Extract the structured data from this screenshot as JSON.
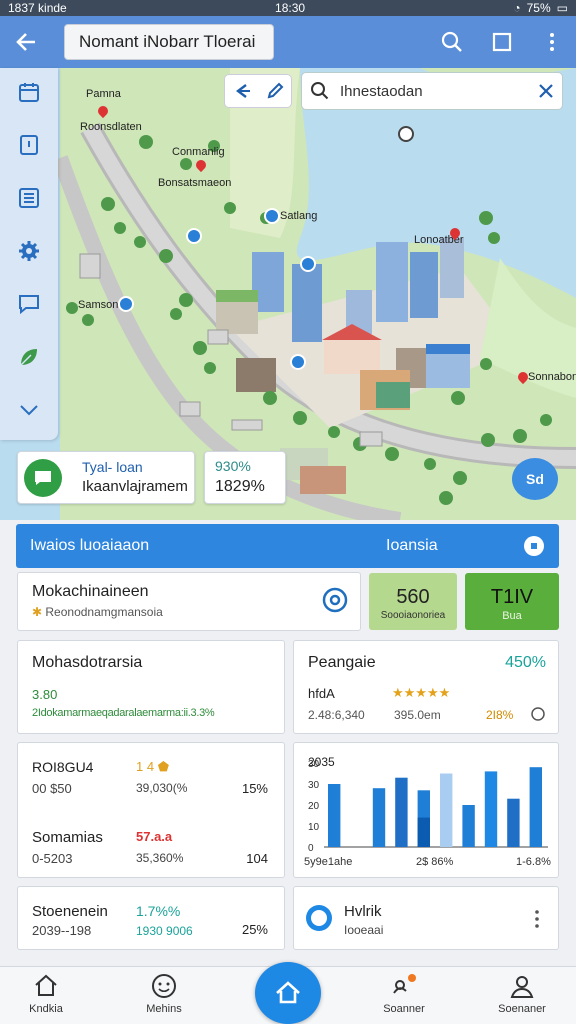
{
  "status": {
    "left": "1837 kinde",
    "time": "18:30",
    "battery": "75%"
  },
  "appbar": {
    "title": "Nomant iNobarr Tloerai"
  },
  "search": {
    "placeholder": "Ihnestaodan"
  },
  "map": {
    "labels": [
      "Pamna",
      "Roonsdlaten",
      "Conmanlig",
      "Bonsatsmaeon",
      "Satlang",
      "Lonoatber",
      "Samson",
      "Sonnabon"
    ]
  },
  "info_left": {
    "line1": "Tyal- loan",
    "line2": "Ikaanvlajramem"
  },
  "info_right": {
    "line1": "930%",
    "line2": "1829%"
  },
  "fab_map": {
    "label": "Sd"
  },
  "section": {
    "title": "Iwaios luoaiaaon",
    "right": "Ioansia"
  },
  "summary": {
    "title": "Mokachinaineen",
    "subtitle": "Reonodnamgmansoia"
  },
  "stat_a": {
    "value": "560",
    "label": "Soooiaonoriea"
  },
  "stat_b": {
    "value": "T1IV",
    "label": "Bua"
  },
  "card1": {
    "title": "Mohasdotrarsia",
    "value": "3.80",
    "detail": "2Idokamarmaeqadaralaemarma:ii.3.3%"
  },
  "card2": {
    "title": "Peangaie",
    "percent": "450%",
    "sub1": "hfdA",
    "sub2": "2.48:6,340",
    "sub3": "395.0em",
    "sub4": "2I8%"
  },
  "card3": {
    "rows": [
      {
        "name": "ROI8GU4",
        "sub": "00 $50",
        "badge": "1 4",
        "amount": "39,030(%",
        "pct": "15%"
      },
      {
        "name": "Somamias",
        "sub": "0-5203",
        "badge": "57.a.a",
        "amount": "35,360%",
        "pct": "104"
      }
    ]
  },
  "card4": {
    "title": "2035",
    "yticks": [
      "30",
      "30",
      "20",
      "10",
      "0"
    ],
    "xlabels": [
      "5y9e1ahe",
      "2$ 86%",
      "1-6.8%"
    ]
  },
  "chart_data": {
    "type": "bar",
    "title": "2035",
    "xlabel": "",
    "ylabel": "",
    "ylim": [
      0,
      40
    ],
    "series": [
      {
        "values": [
          30,
          0,
          28,
          0,
          27,
          0,
          20,
          0,
          0,
          38
        ]
      },
      {
        "values": [
          0,
          0,
          0,
          0,
          0,
          35,
          0,
          0,
          0,
          0
        ]
      },
      {
        "values": [
          0,
          0,
          0,
          33,
          0,
          0,
          0,
          0,
          23,
          0
        ]
      },
      {
        "values": [
          0,
          0,
          0,
          0,
          0,
          0,
          0,
          36,
          0,
          0
        ]
      },
      {
        "values": [
          0,
          0,
          0,
          0,
          14,
          0,
          0,
          0,
          0,
          0
        ]
      }
    ],
    "categories": [
      "1",
      "2",
      "3",
      "4",
      "5",
      "6",
      "7",
      "8",
      "9",
      "10"
    ]
  },
  "card5": {
    "line1": "Stoenenein",
    "line2": "2039--198",
    "badge": "1.7%%",
    "amount": "1930 9006",
    "pct": "25%"
  },
  "card6": {
    "title": "Hvlrik",
    "sub": "Iooeaai"
  },
  "tabs": [
    "Kndkia",
    "Mehins",
    "Soanner",
    "Soenaner"
  ]
}
